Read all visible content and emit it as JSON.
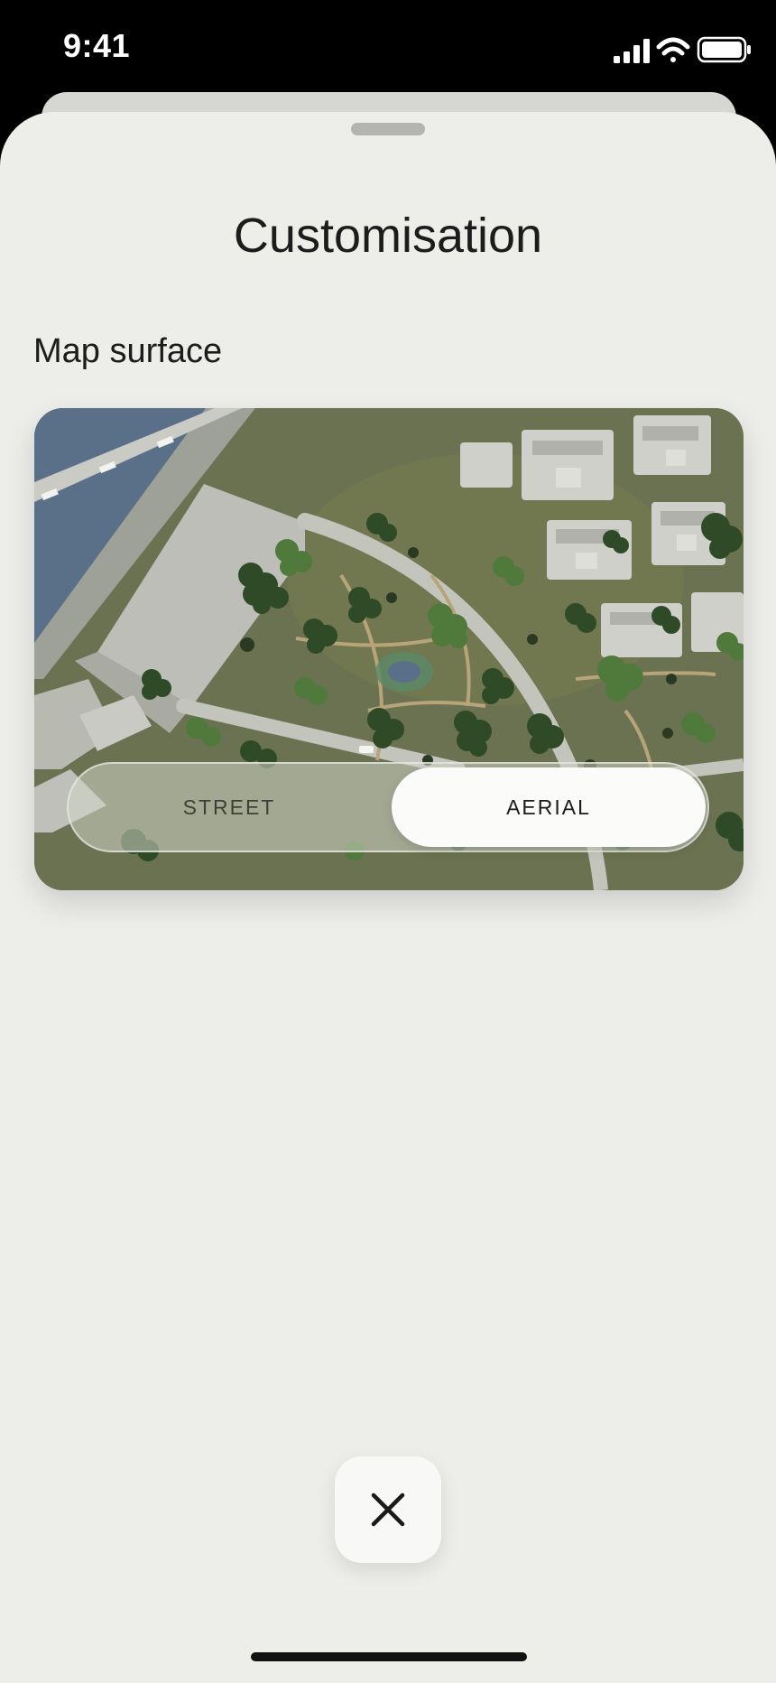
{
  "status_bar": {
    "time": "9:41",
    "icons": [
      "cellular-signal-icon",
      "wifi-icon",
      "battery-icon"
    ]
  },
  "sheet": {
    "title": "Customisation",
    "section_label": "Map surface"
  },
  "map_surface": {
    "options": [
      {
        "label": "STREET",
        "selected": false
      },
      {
        "label": "AERIAL",
        "selected": true
      }
    ]
  },
  "close_button": {
    "icon": "close-icon"
  },
  "colors": {
    "sheet_background": "#ededea",
    "selected_pill": "#fbfbf9",
    "water": "#5a7088",
    "grass": "#6b7252",
    "tree_dark": "#2f4a27",
    "tree_light": "#4f7a3c"
  }
}
